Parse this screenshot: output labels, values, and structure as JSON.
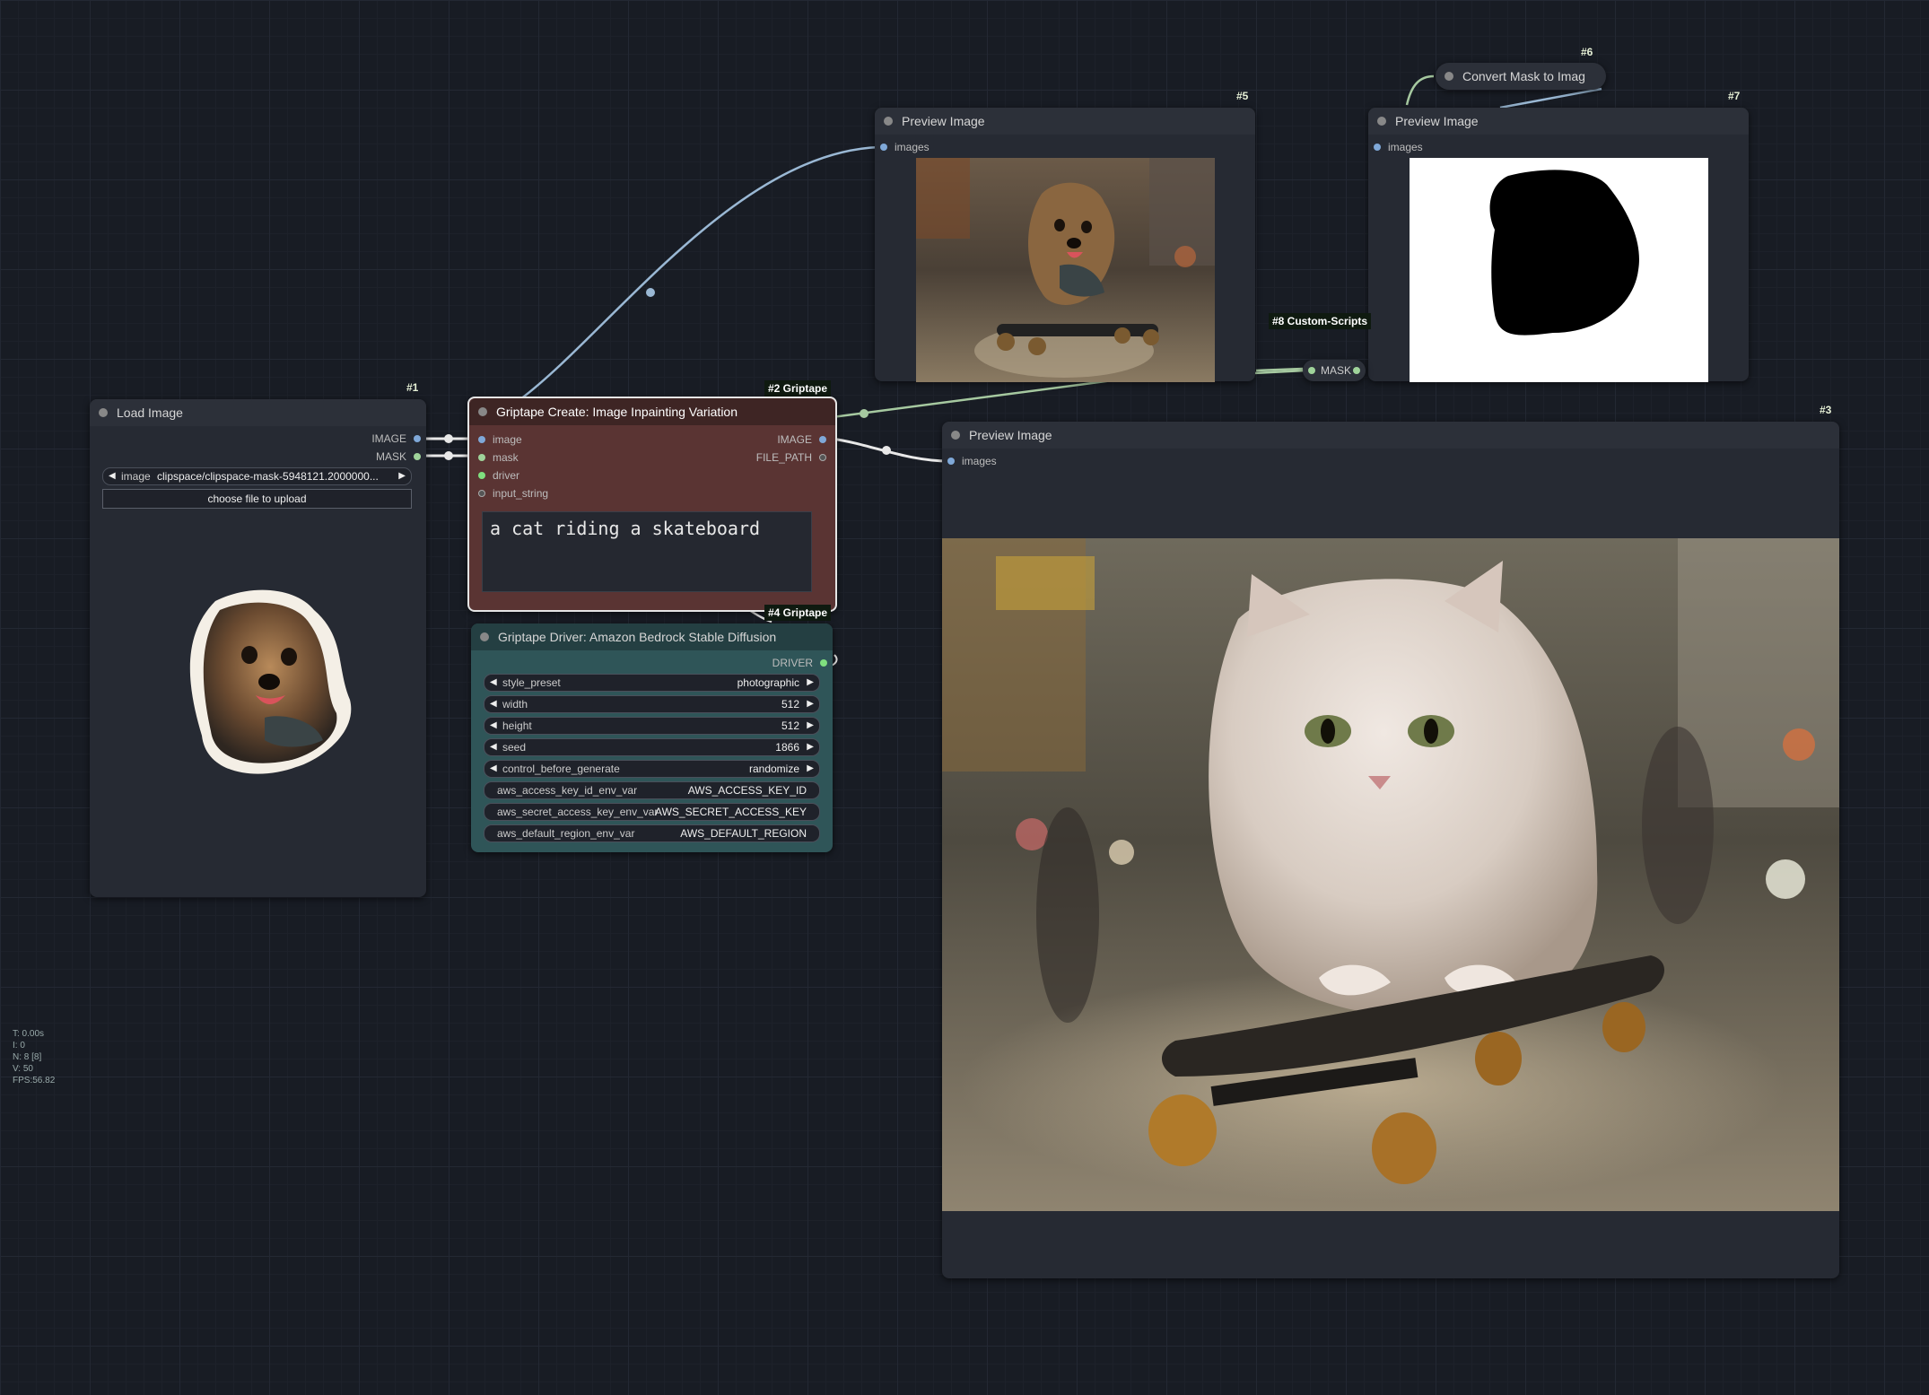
{
  "nodes": {
    "load_image": {
      "id": "#1",
      "title": "Load Image",
      "outputs": [
        "IMAGE",
        "MASK"
      ],
      "image_widget": {
        "label": "image",
        "value": "clipspace/clipspace-mask-5948121.2000000..."
      },
      "upload_label": "choose file to upload"
    },
    "griptape_create": {
      "badge": "#2 Griptape",
      "title": "Griptape Create: Image Inpainting Variation",
      "inputs": [
        "image",
        "mask",
        "driver",
        "input_string"
      ],
      "outputs": [
        "IMAGE",
        "FILE_PATH"
      ],
      "prompt": "a cat riding a skateboard"
    },
    "griptape_driver": {
      "badge": "#4 Griptape",
      "title": "Griptape Driver: Amazon Bedrock Stable Diffusion",
      "output": "DRIVER",
      "widgets": [
        {
          "label": "style_preset",
          "value": "photographic"
        },
        {
          "label": "width",
          "value": "512"
        },
        {
          "label": "height",
          "value": "512"
        },
        {
          "label": "seed",
          "value": "1866"
        },
        {
          "label": "control_before_generate",
          "value": "randomize"
        }
      ],
      "text_widgets": [
        {
          "label": "aws_access_key_id_env_var",
          "value": "AWS_ACCESS_KEY_ID"
        },
        {
          "label": "aws_secret_access_key_env_var",
          "value": "AWS_SECRET_ACCESS_KEY"
        },
        {
          "label": "aws_default_region_env_var",
          "value": "AWS_DEFAULT_REGION"
        }
      ]
    },
    "preview5": {
      "id": "#5",
      "title": "Preview Image",
      "input": "images"
    },
    "preview7": {
      "id": "#7",
      "title": "Preview Image",
      "input": "images"
    },
    "preview3": {
      "id": "#3",
      "title": "Preview Image",
      "input": "images"
    },
    "convert_mask": {
      "id": "#6",
      "title": "Convert Mask to Imag"
    },
    "custom_scripts": {
      "badge": "#8 Custom-Scripts",
      "label": "MASK"
    }
  },
  "stats": [
    "T: 0.00s",
    "I: 0",
    "N: 8 [8]",
    "V: 50",
    "FPS:56.82"
  ],
  "colors": {
    "canvas": "#181c24",
    "node": "#262a33",
    "create_node": "#5a3433",
    "driver_node": "#2f5558",
    "link": "#9ab8d4",
    "mask_link": "#a6c9a0"
  }
}
